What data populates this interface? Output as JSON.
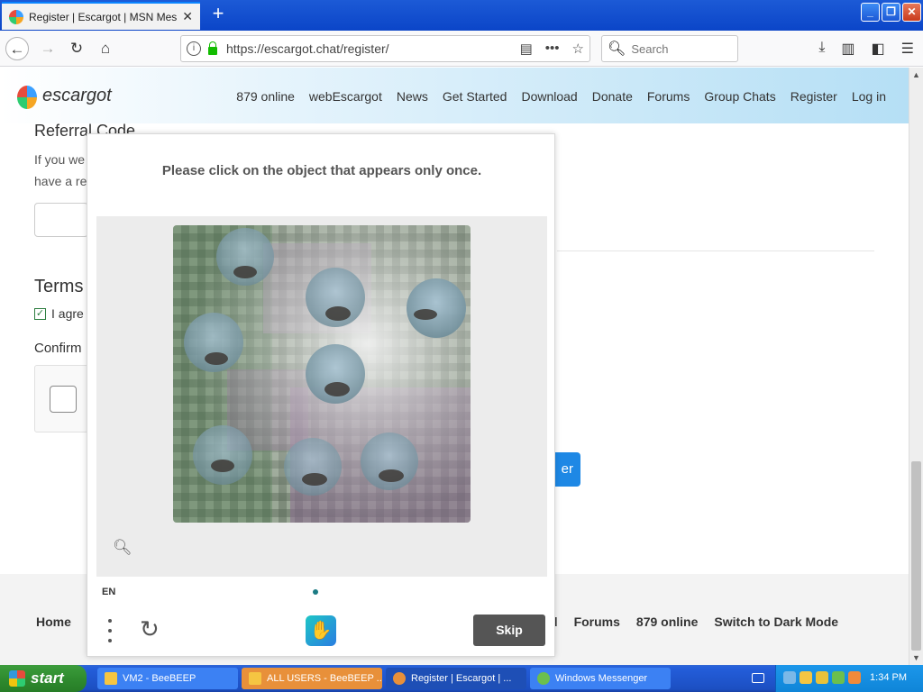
{
  "browser": {
    "tab_title": "Register | Escargot | MSN Messen",
    "url": "https://escargot.chat/register/",
    "search_placeholder": "Search"
  },
  "site": {
    "logo_text": "escargot",
    "nav": [
      "879 online",
      "webEscargot",
      "News",
      "Get Started",
      "Download",
      "Donate",
      "Forums",
      "Group Chats",
      "Register",
      "Log in"
    ]
  },
  "form": {
    "referral_label": "Referral Code",
    "referral_help": "If you we have a re",
    "terms_label": "Terms",
    "agree_text": "I agre",
    "confirm_label": "Confirm",
    "register_button": "er"
  },
  "footer": {
    "home": "Home",
    "right_links": [
      "d",
      "Forums",
      "879 online",
      "Switch to Dark Mode"
    ]
  },
  "captcha": {
    "prompt": "Please click on the object that appears only once.",
    "language": "EN",
    "skip_label": "Skip"
  },
  "taskbar": {
    "start_label": "start",
    "items": [
      "VM2 - BeeBEEP",
      "ALL USERS - BeeBEEP ...",
      "Register | Escargot | ...",
      "Windows Messenger"
    ],
    "clock": "1:34 PM"
  }
}
